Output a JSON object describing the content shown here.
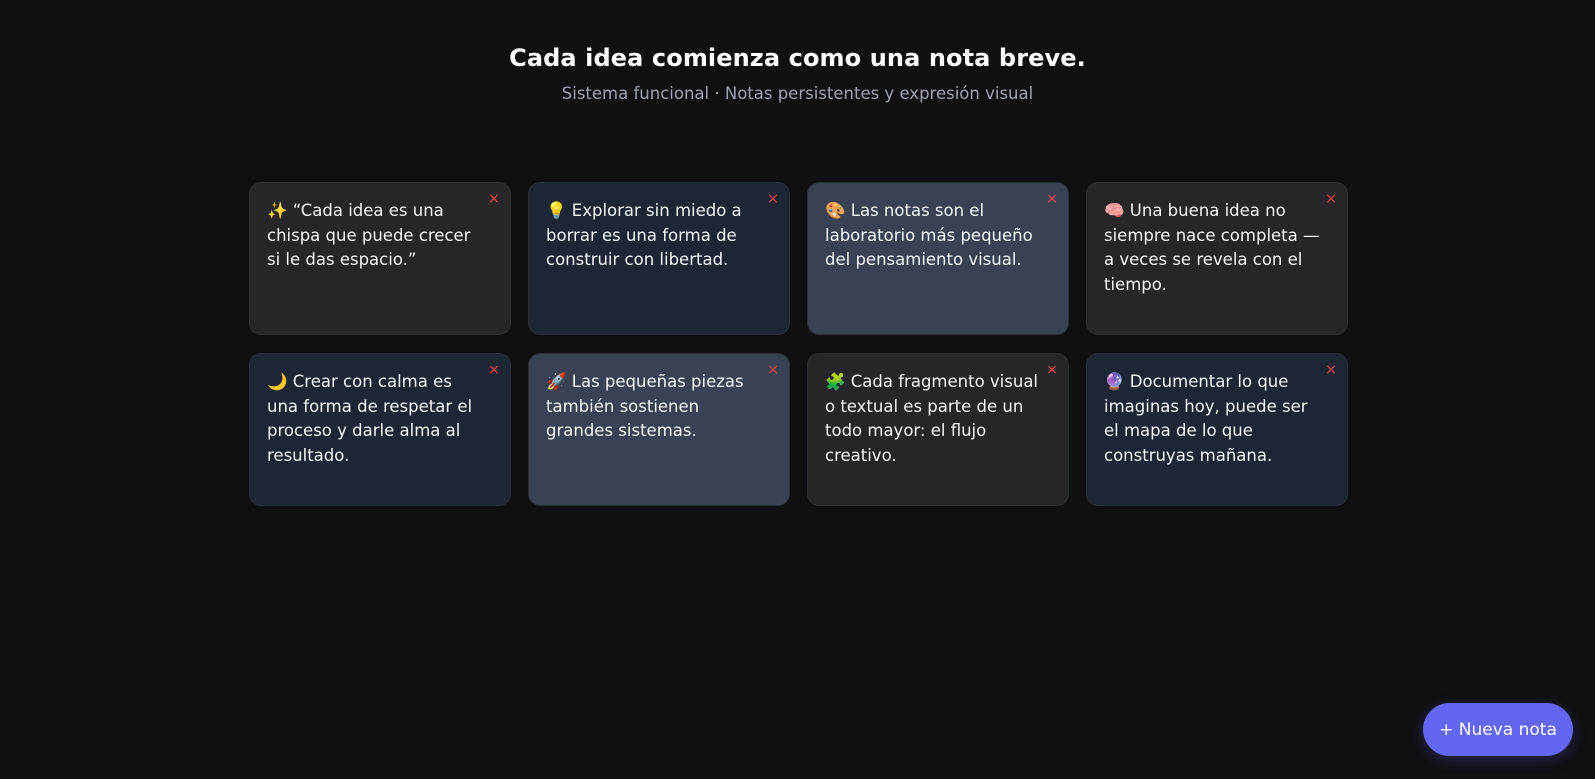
{
  "header": {
    "title": "Cada idea comienza como una nota breve.",
    "subtitle": "Sistema funcional · Notas persistentes y expresión visual"
  },
  "notes": [
    {
      "text": "✨ “Cada idea es una chispa que puede crecer si le das espacio.”",
      "close": "×"
    },
    {
      "text": "💡 Explorar sin miedo a borrar es una forma de construir con libertad.",
      "close": "×"
    },
    {
      "text": "🎨 Las notas son el laboratorio más pequeño del pensamiento visual.",
      "close": "×"
    },
    {
      "text": "🧠 Una buena idea no siempre nace completa — a veces se revela con el tiempo.",
      "close": "×"
    },
    {
      "text": "🌙 Crear con calma es una forma de respetar el proceso y darle alma al resultado.",
      "close": "×"
    },
    {
      "text": "🚀 Las pequeñas piezas también sostienen grandes sistemas.",
      "close": "×"
    },
    {
      "text": "🧩 Cada fragmento visual o textual es parte de un todo mayor: el flujo creativo.",
      "close": "×"
    },
    {
      "text": "🔮 Documentar lo que imaginas hoy, puede ser el mapa de lo que construyas mañana.",
      "close": "×"
    }
  ],
  "fab": {
    "label": "+ Nueva nota"
  },
  "colors": {
    "background": "#0f1012",
    "note_dark": "#262628",
    "note_navy": "#1e2636",
    "note_slate": "#394254",
    "close": "#ef4444",
    "accent": "#6366f1"
  }
}
